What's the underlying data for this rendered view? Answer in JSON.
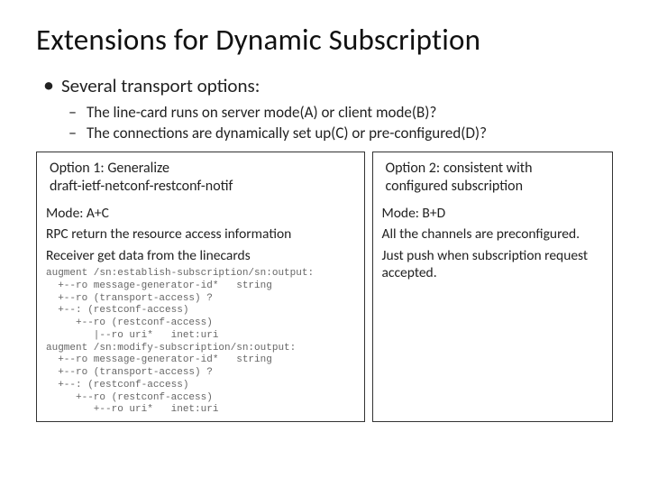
{
  "title": "Extensions for Dynamic Subscription",
  "bullets": {
    "l1": "Several transport options:",
    "l2a": "The line-card runs on server mode(A) or client mode(B)?",
    "l2b": "The connections are dynamically set up(C) or pre-configured(D)?"
  },
  "option1": {
    "title_line1": "Option 1: Generalize",
    "title_line2": "draft-ietf-netconf-restconf-notif",
    "mode": "Mode: A+C",
    "body1": "RPC return the resource access information",
    "body2": "Receiver get data from the linecards",
    "yang": "augment /sn:establish-subscription/sn:output:\n  +--ro message-generator-id*   string\n  +--ro (transport-access) ?\n  +--: (restconf-access)\n     +--ro (restconf-access)\n        |--ro uri*   inet:uri\naugment /sn:modify-subscription/sn:output:\n  +--ro message-generator-id*   string\n  +--ro (transport-access) ?\n  +--: (restconf-access)\n     +--ro (restconf-access)\n        +--ro uri*   inet:uri"
  },
  "option2": {
    "title_line1": "Option 2: consistent with",
    "title_line2": "configured subscription",
    "mode": "Mode: B+D",
    "body1": "All the channels are preconfigured.",
    "body2": "Just push when subscription request accepted."
  }
}
